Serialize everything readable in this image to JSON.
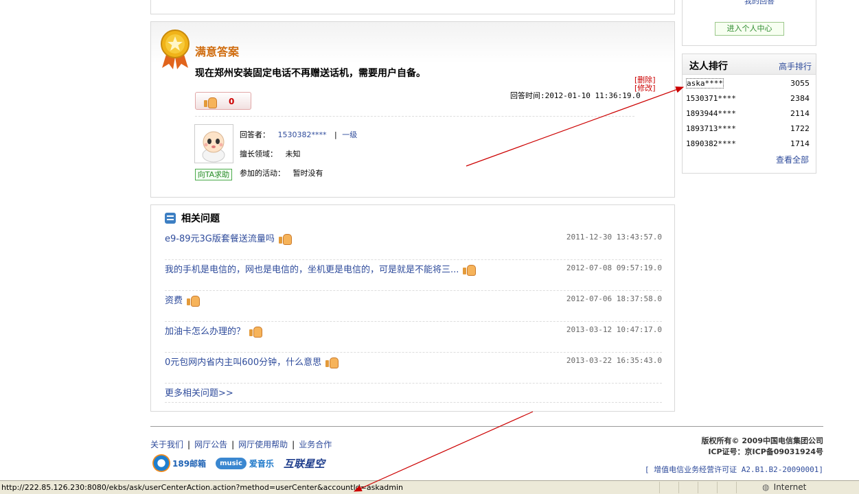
{
  "answer": {
    "title": "满意答案",
    "text": "现在郑州安装固定电话不再赠送话机，需要用户自备。",
    "delete_label": "[删除]",
    "edit_label": "[修改]",
    "time": "回答时间:2012-01-10 11:36:19.0",
    "like_count": "0",
    "answerer_label": "回答者：",
    "answerer_name": "1530382****",
    "answerer_sep": "|",
    "answerer_level": "一级",
    "expertise_label": "擅长领域：",
    "expertise_value": "未知",
    "activity_label": "参加的活动：",
    "activity_value": "暂时没有",
    "help_button": "向TA求助"
  },
  "related": {
    "title": "相关问题",
    "items": [
      {
        "question": "e9-89元3G版套餐送流量吗",
        "time": "2011-12-30 13:43:57.0"
      },
      {
        "question": "我的手机是电信的，网也是电信的，坐机更是电信的，可是就是不能将三...",
        "time": "2012-07-08 09:57:19.0"
      },
      {
        "question": "资费",
        "time": "2012-07-06 18:37:58.0"
      },
      {
        "question": "加油卡怎么办理的？",
        "time": "2013-03-12 10:47:17.0"
      },
      {
        "question": "0元包网内省内主叫600分钟，什么意思",
        "time": "2013-03-22 16:35:43.0"
      }
    ],
    "more_label": "更多相关问题>>"
  },
  "sidebar": {
    "my_answer_label": "我的回答",
    "center_button": "进入个人中心",
    "rank": {
      "title": "达人排行",
      "expert_rank_label": "高手排行",
      "rows": [
        {
          "name": "aska****",
          "score": "3055"
        },
        {
          "name": "1530371****",
          "score": "2384"
        },
        {
          "name": "1893944****",
          "score": "2114"
        },
        {
          "name": "1893713****",
          "score": "1722"
        },
        {
          "name": "1890382****",
          "score": "1714"
        }
      ],
      "view_all": "查看全部"
    }
  },
  "footer": {
    "links": [
      "关于我们",
      "网厅公告",
      "网厅使用帮助",
      "业务合作"
    ],
    "separator": "|",
    "logos": [
      "189邮箱",
      "爱音乐",
      "互联星空"
    ],
    "copyright_line1": "版权所有© 2009中国电信集团公司",
    "copyright_line2": "ICP证号：京ICP备09031924号",
    "license": "[ 增值电信业务经营许可证 A2.B1.B2-20090001]"
  },
  "statusbar": {
    "url": "http://222.85.126.230:8080/ekbs/ask/userCenterAction.action?method=userCenter&accountId=askadmin",
    "zone": "Internet"
  },
  "annotation_color": "#cc0000"
}
